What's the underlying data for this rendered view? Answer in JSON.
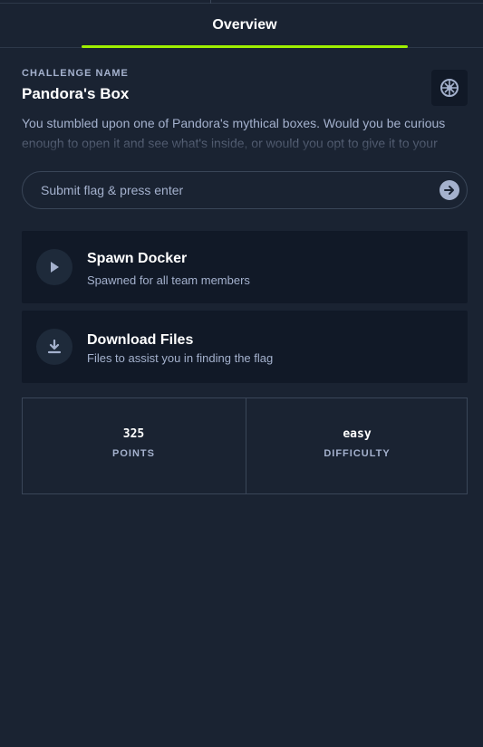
{
  "tabs": {
    "active_label": "Overview"
  },
  "challenge": {
    "section_label": "CHALLENGE NAME",
    "name": "Pandora's Box",
    "description": "You stumbled upon one of Pandora's mythical boxes. Would you be curious enough to open it and see what's inside, or would you opt to give it to your",
    "badge_icon": "brain-icon"
  },
  "flag": {
    "placeholder": "Submit flag & press enter",
    "value": "",
    "submit_icon": "arrow-right-circle-icon"
  },
  "actions": [
    {
      "title": "Spawn Docker",
      "subtitle": "Spawned for all team members",
      "icon": "play-icon"
    },
    {
      "title": "Download Files",
      "subtitle": "Files to assist you in finding the flag",
      "icon": "download-icon"
    }
  ],
  "stats": {
    "points_value": "325",
    "points_label": "POINTS",
    "difficulty_value": "easy",
    "difficulty_label": "DIFFICULTY"
  },
  "colors": {
    "background": "#1a2332",
    "card": "#111927",
    "accent": "#9fef00",
    "muted_text": "#a4b1cd",
    "border": "#3a4658"
  }
}
